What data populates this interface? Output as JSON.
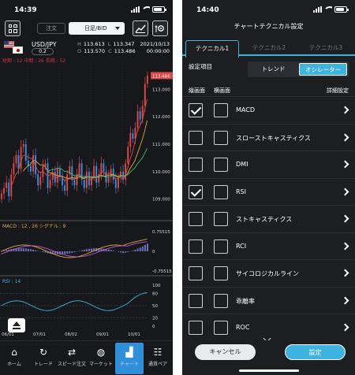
{
  "left": {
    "status": {
      "time": "14:39"
    },
    "toolbar": {
      "order_label": "注文",
      "select_value": "日足/BID"
    },
    "quote": {
      "pair": "USD/JPY",
      "spread": "0.2",
      "high_label": "H",
      "high": "113.613",
      "low_label": "L",
      "low": "113.347",
      "open_label": "O",
      "open": "113.570",
      "close_label": "C",
      "close": "113.486",
      "date": "2021/10/13",
      "time": "00:00:00"
    },
    "chart": {
      "ma_legend": "短期 : 12  中期 : 26  長期 : 52",
      "price_axis": [
        "113.486",
        "113.000",
        "112.000",
        "111.000",
        "110.000",
        "109.000"
      ],
      "macd_legend": "MACD : 12 , 26  シグナル : 9",
      "macd_axis": [
        "0.75515",
        "0",
        "-0.75515"
      ],
      "rsi_legend": "RSI : 14",
      "rsi_axis": [
        "100",
        "80",
        "50",
        "20",
        "0"
      ],
      "x_labels": [
        "06/01",
        "07/01",
        "08/02",
        "09/01",
        "10/01"
      ]
    },
    "chart_data": {
      "type": "candlestick",
      "instrument": "USD/JPY",
      "price_ylim": [
        108.5,
        113.9
      ],
      "last_price": 113.486,
      "approx_closes": [
        109.2,
        109.4,
        109.6,
        109.1,
        109.9,
        110.3,
        110.6,
        110.1,
        110.9,
        111.0,
        110.4,
        110.2,
        110.0,
        110.6,
        109.9,
        109.5,
        109.8,
        110.2,
        110.3,
        109.4,
        109.7,
        110.0,
        109.6,
        110.1,
        109.8,
        109.5,
        109.3,
        109.9,
        110.2,
        109.7,
        109.5,
        109.9,
        110.3,
        109.7,
        109.4,
        110.0,
        109.5,
        109.8,
        110.2,
        109.6,
        109.9,
        110.3,
        110.0,
        109.6,
        109.8,
        110.1,
        109.7,
        109.4,
        109.8,
        110.0,
        109.7,
        110.3,
        110.9,
        111.4,
        111.2,
        111.6,
        112.2,
        111.9,
        112.4,
        113.2,
        113.5
      ],
      "macd_ylim": [
        -0.75515,
        0.75515
      ],
      "rsi_ylim": [
        0,
        100
      ]
    },
    "tabs": [
      {
        "label": "ホーム",
        "icon": "⌂"
      },
      {
        "label": "トレード",
        "icon": "↻"
      },
      {
        "label": "スピード注文",
        "icon": "⇄"
      },
      {
        "label": "マーケット",
        "icon": "◍"
      },
      {
        "label": "チャート",
        "icon": "▟"
      },
      {
        "label": "通貨ペア",
        "icon": "☷"
      }
    ]
  },
  "right": {
    "status": {
      "time": "14:40"
    },
    "title": "チャートテクニカル設定",
    "tabs": [
      "テクニカル1",
      "テクニカル2",
      "テクニカル3"
    ],
    "setting_label": "設定項目",
    "segment": {
      "trend": "トレンド",
      "oscillator": "オシレーター"
    },
    "col_vertical": "縦画面",
    "col_horizontal": "横画面",
    "col_detail": "詳細設定",
    "items": [
      {
        "label": "MACD",
        "v": true,
        "h": false
      },
      {
        "label": "スローストキャスティクス",
        "v": false,
        "h": false
      },
      {
        "label": "DMI",
        "v": false,
        "h": false
      },
      {
        "label": "RSI",
        "v": true,
        "h": false
      },
      {
        "label": "ストキャスティクス",
        "v": false,
        "h": false
      },
      {
        "label": "RCI",
        "v": false,
        "h": false
      },
      {
        "label": "サイコロジカルライン",
        "v": false,
        "h": false
      },
      {
        "label": "乖離率",
        "v": false,
        "h": false
      },
      {
        "label": "ROC",
        "v": false,
        "h": false
      }
    ],
    "cancel_label": "キャンセル",
    "ok_label": "設定"
  }
}
